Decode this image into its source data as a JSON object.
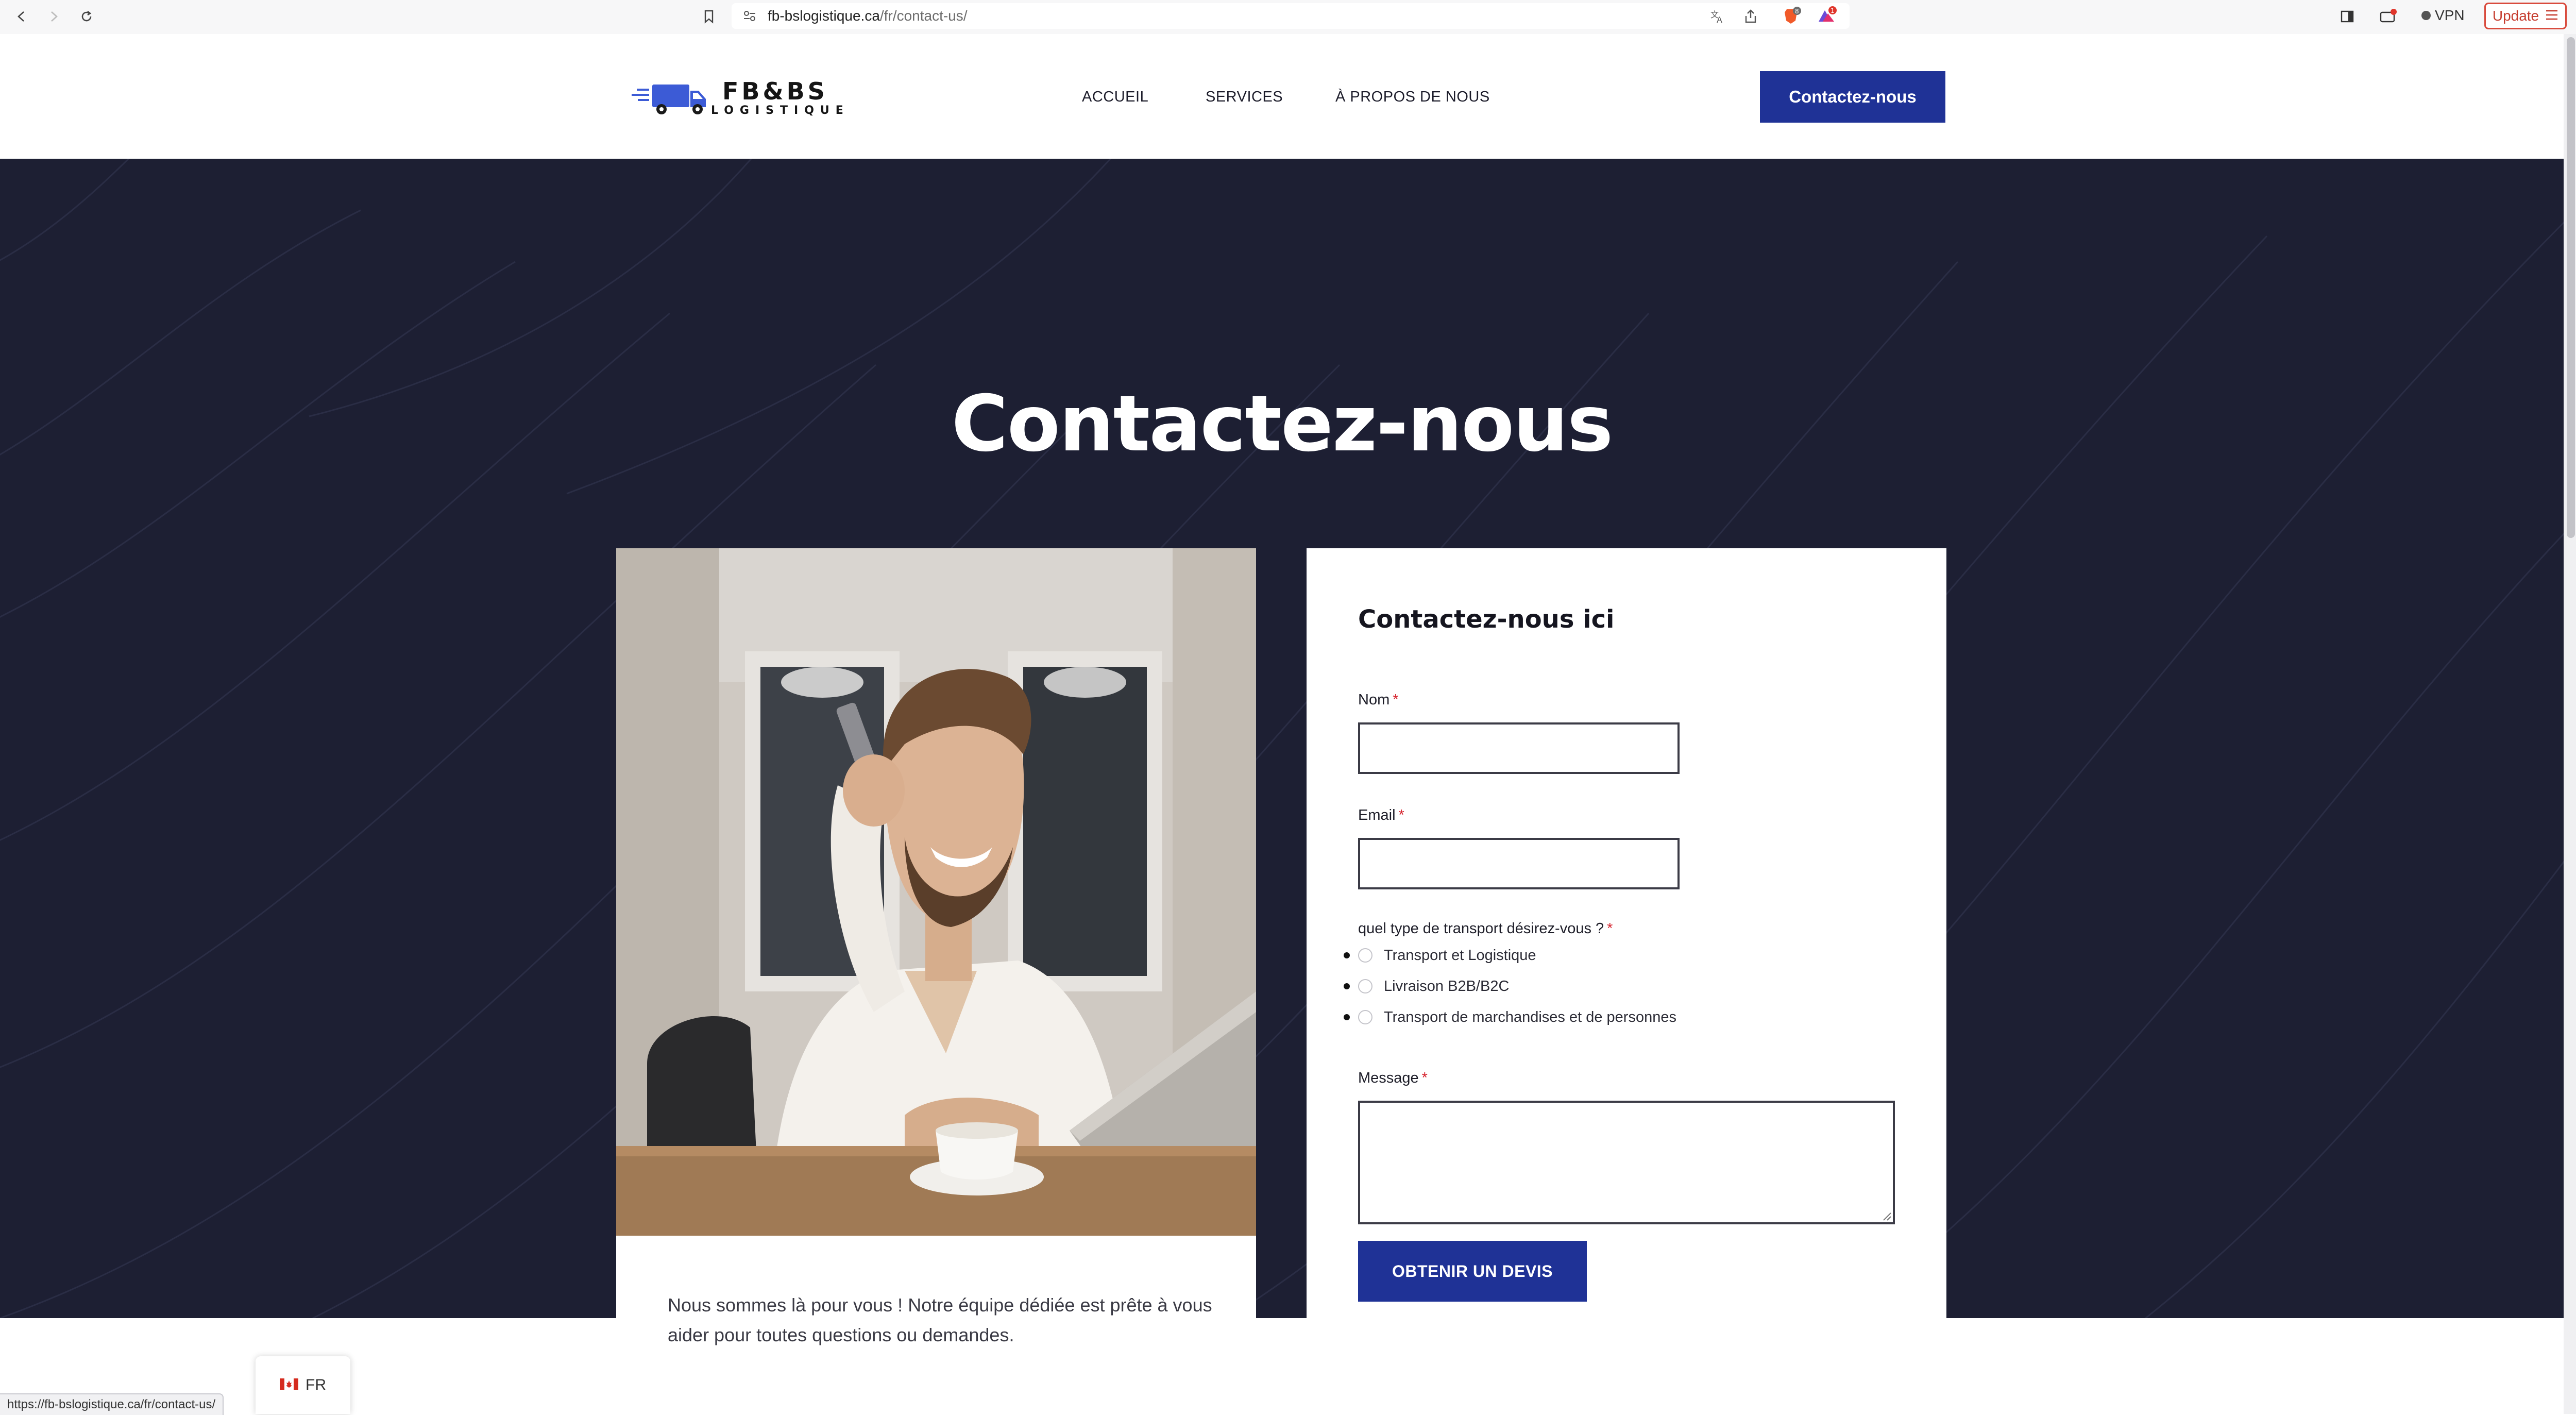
{
  "browser": {
    "url_host": "fb-bslogistique.ca",
    "url_path": "/fr/contact-us/",
    "vpn_label": "VPN",
    "update_label": "Update",
    "shield_badge": "8",
    "alert_badge": "1"
  },
  "header": {
    "logo_brand": "FB&BS",
    "logo_sub": "LOGISTIQUE",
    "nav": [
      "ACCUEIL",
      "SERVICES",
      "À PROPOS DE NOUS"
    ],
    "cta": "Contactez-nous"
  },
  "hero": {
    "title": "Contactez-nous"
  },
  "image_card": {
    "text": "Nous sommes là pour vous ! Notre équipe dédiée est prête à vous aider pour toutes questions ou demandes."
  },
  "form": {
    "title": "Contactez-nous ici",
    "name_label": "Nom",
    "email_label": "Email",
    "transport_label": "quel type de transport désirez-vous ?",
    "required_mark": "*",
    "options": [
      "Transport et Logistique",
      "Livraison B2B/B2C",
      "Transport de marchandises et de personnes"
    ],
    "message_label": "Message",
    "submit": "OBTENIR UN DEVIS"
  },
  "language": {
    "code": "FR"
  },
  "status_bar": {
    "url": "https://fb-bslogistique.ca/fr/contact-us/"
  },
  "colors": {
    "brand_blue": "#1f3296",
    "hero_bg": "#1d1f33",
    "required_red": "#d6252f"
  },
  "icons": [
    "back-arrow-icon",
    "forward-arrow-icon",
    "reload-icon",
    "bookmark-icon",
    "site-settings-icon",
    "translate-icon",
    "share-icon",
    "brave-shield-icon",
    "brave-rewards-icon",
    "sidebar-icon",
    "wallet-icon",
    "menu-icon",
    "canada-flag-icon",
    "truck-icon"
  ]
}
